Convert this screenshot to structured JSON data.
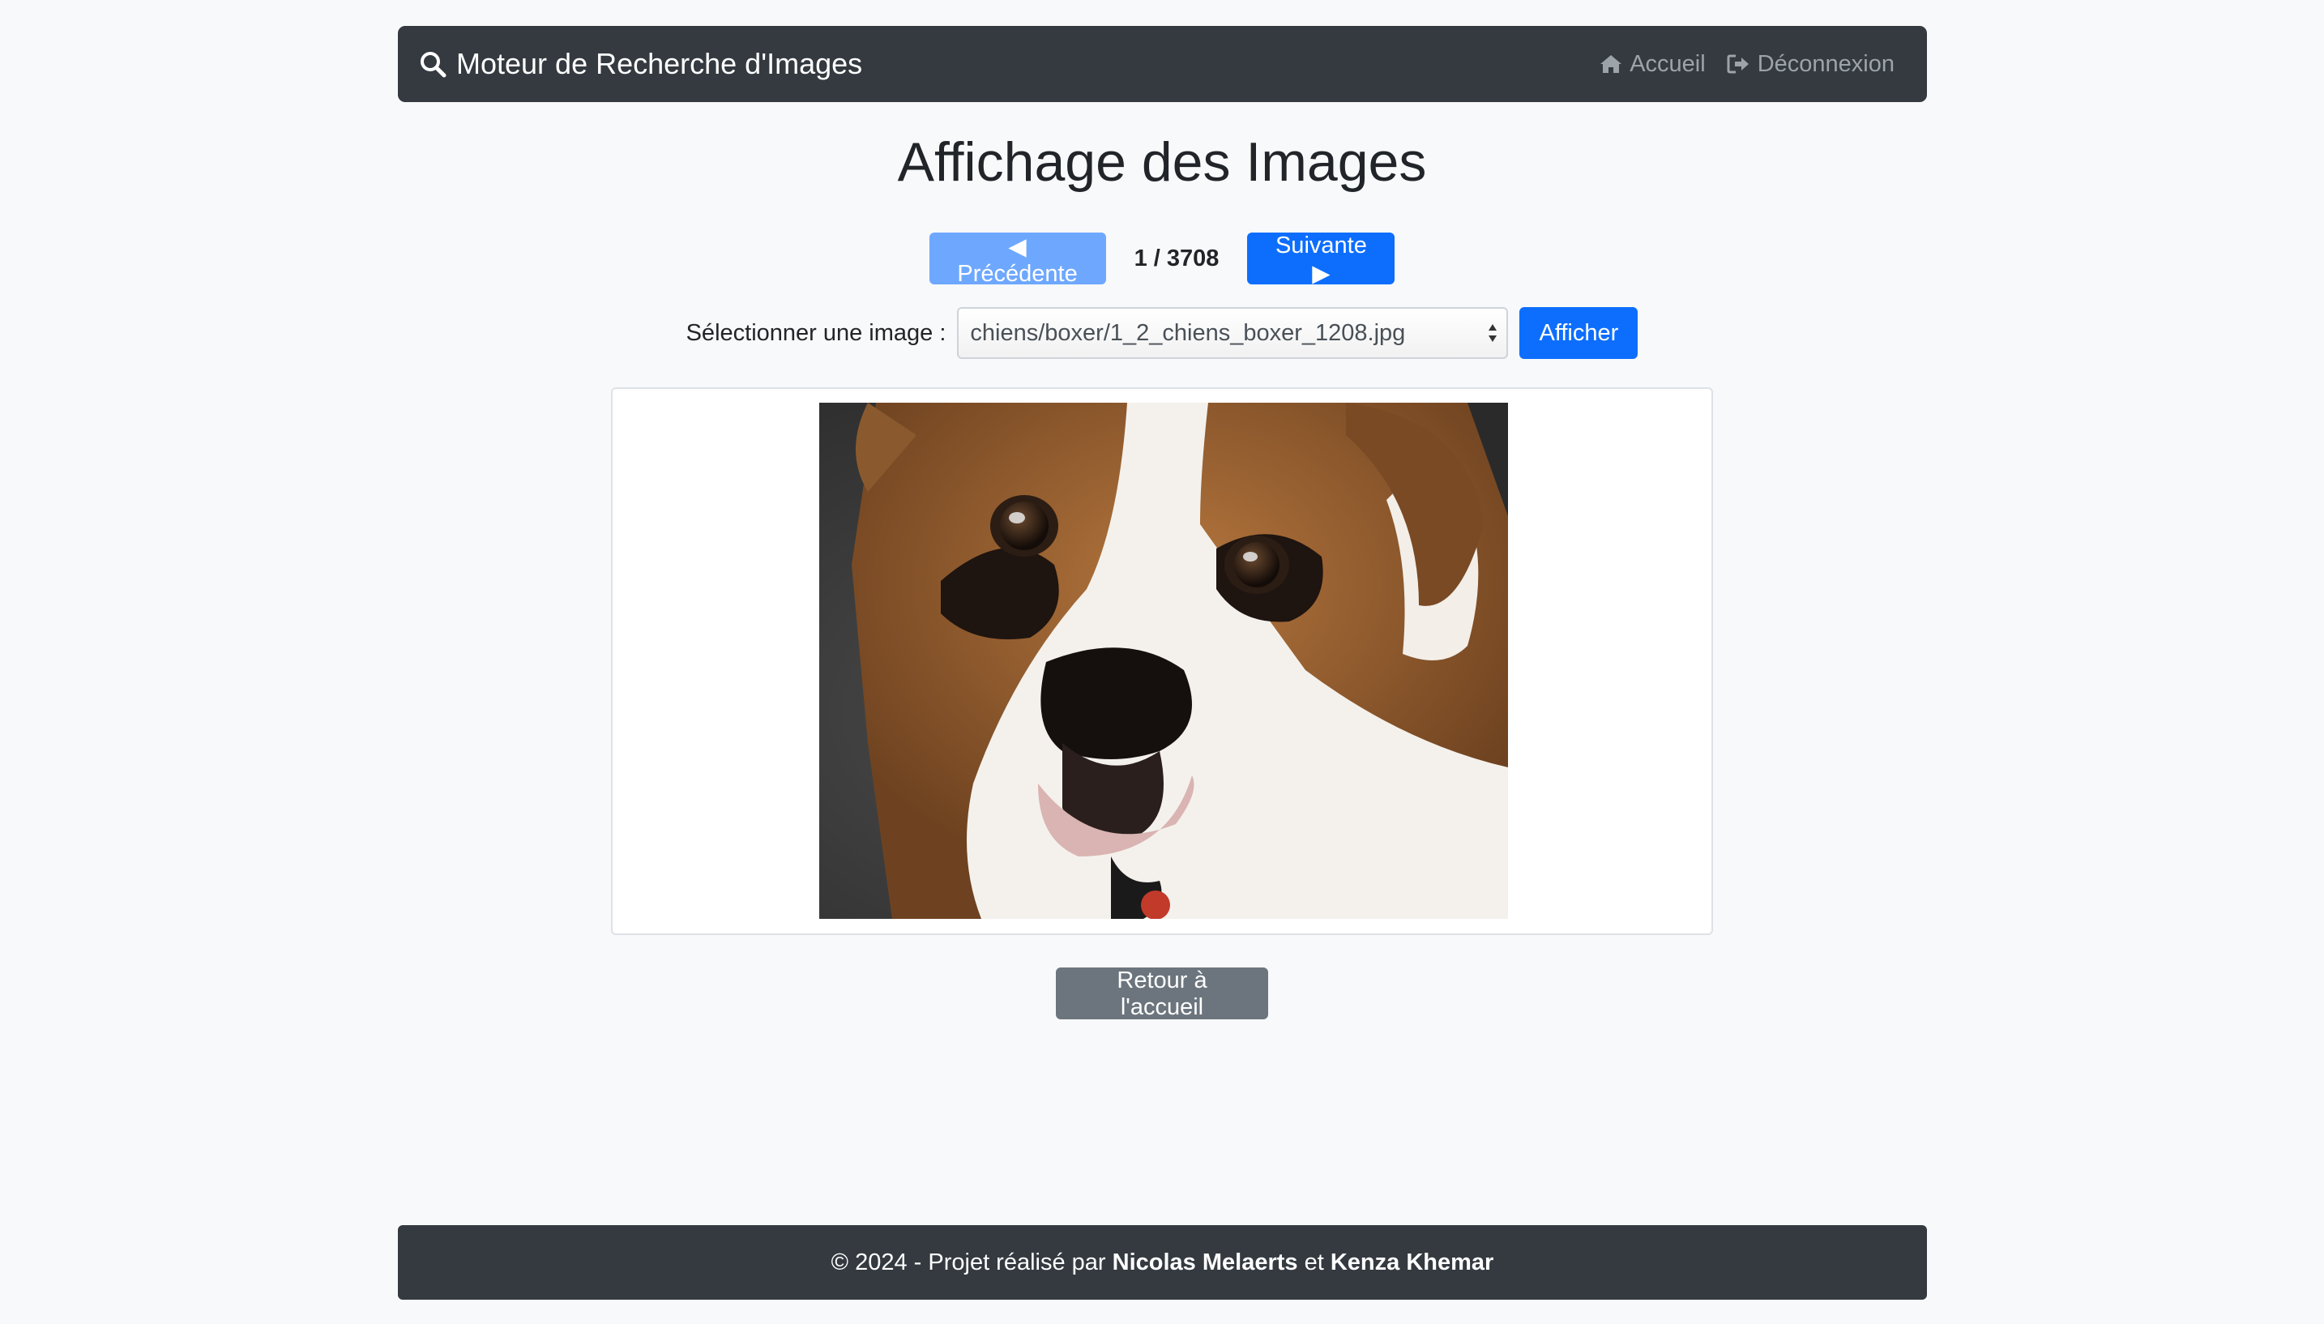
{
  "navbar": {
    "brand": "Moteur de Recherche d'Images",
    "links": [
      {
        "label": "Accueil",
        "icon": "home-icon"
      },
      {
        "label": "Déconnexion",
        "icon": "sign-out-icon"
      }
    ]
  },
  "page": {
    "title": "Affichage des Images",
    "pager": {
      "prev_label": "◀ Précédente",
      "counter": "1 / 3708",
      "next_label": "Suivante ▶"
    },
    "selector": {
      "label": "Sélectionner une image :",
      "selected": "chiens/boxer/1_2_chiens_boxer_1208.jpg",
      "button": "Afficher"
    },
    "image": {
      "subject": "boxer dog face"
    },
    "back_button": "Retour à l'accueil"
  },
  "footer": {
    "prefix": "© 2024 - Projet réalisé par",
    "author1": "Nicolas Melaerts",
    "conjunction": "et",
    "author2": "Kenza Khemar"
  },
  "colors": {
    "navbar_bg": "#343a40",
    "primary": "#0d6efd",
    "primary_disabled": "#6ea8fe",
    "secondary": "#6c757d",
    "page_bg": "#f8f9fa"
  }
}
